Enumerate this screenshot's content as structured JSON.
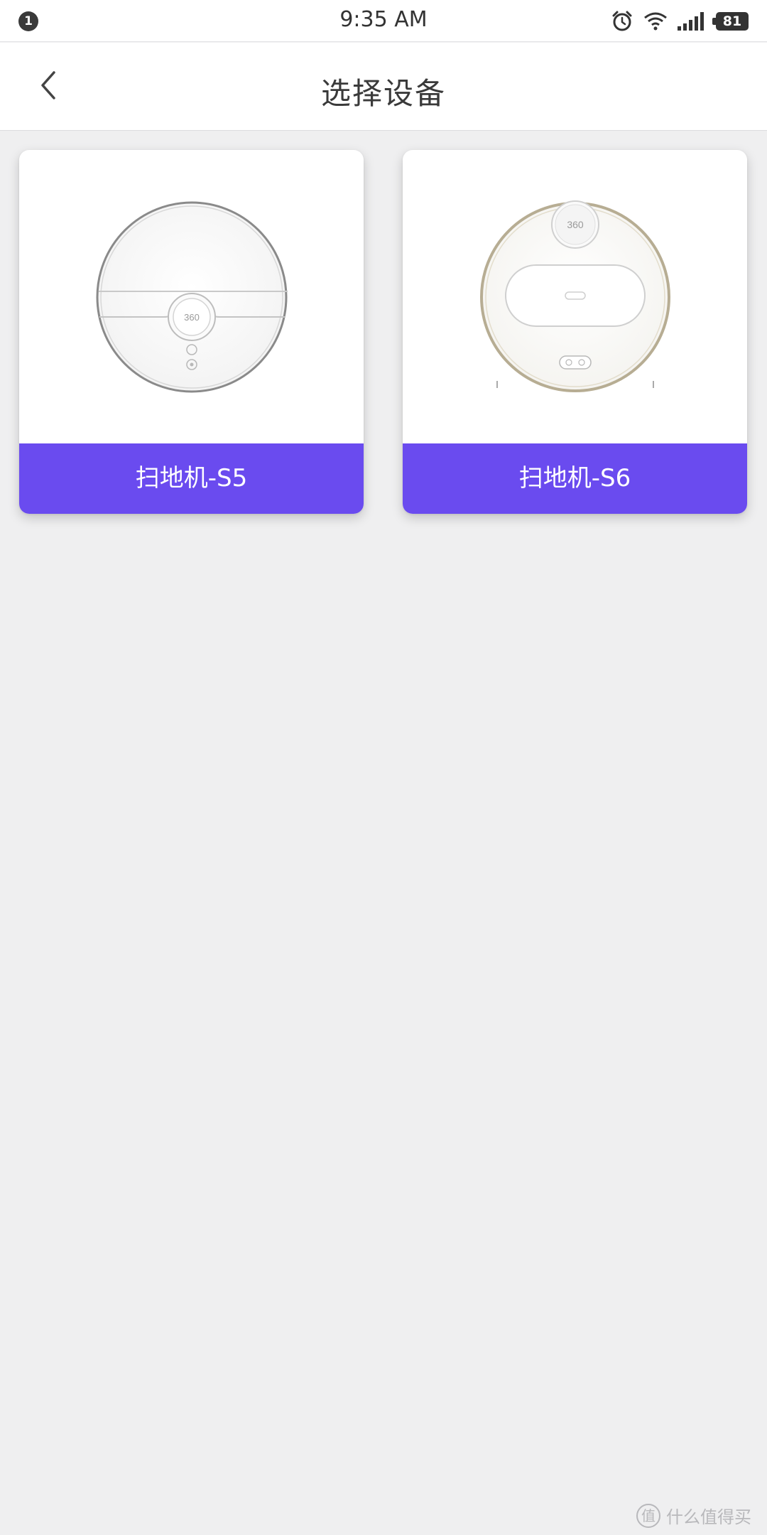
{
  "status_bar": {
    "notification_count": "1",
    "time": "9:35 AM",
    "battery": "81"
  },
  "nav": {
    "title": "选择设备"
  },
  "devices": [
    {
      "label": "扫地机-S5",
      "brand_mark": "360"
    },
    {
      "label": "扫地机-S6",
      "brand_mark": "360"
    }
  ],
  "watermark": {
    "logo": "值",
    "text": "什么值得买"
  },
  "colors": {
    "accent": "#6a4bef",
    "background": "#efeff0"
  }
}
